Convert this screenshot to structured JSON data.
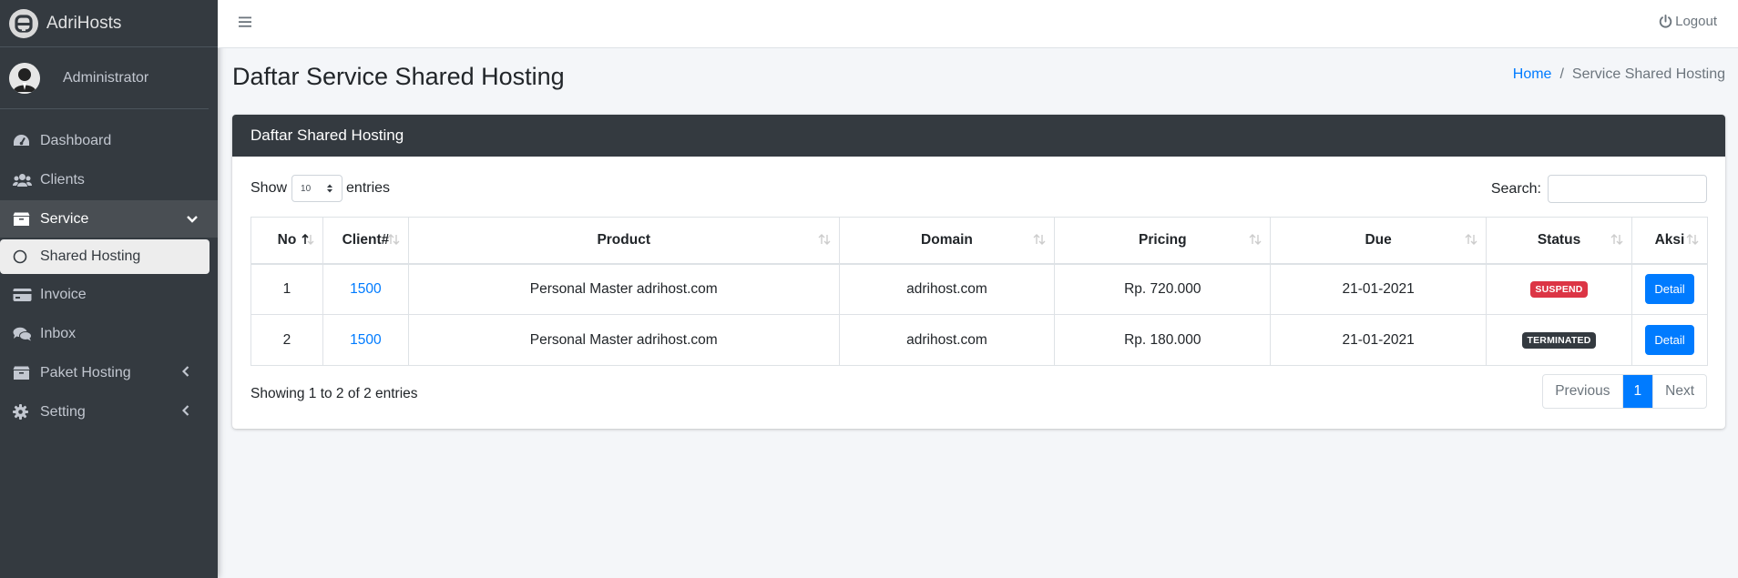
{
  "brand": {
    "name": "AdriHosts"
  },
  "user": {
    "name": "Administrator"
  },
  "sidebar": {
    "items": [
      {
        "label": "Dashboard",
        "icon": "tachometer-icon"
      },
      {
        "label": "Clients",
        "icon": "users-icon"
      },
      {
        "label": "Service",
        "icon": "box-icon"
      },
      {
        "label": "Shared Hosting",
        "icon": "circle-icon"
      },
      {
        "label": "Invoice",
        "icon": "credit-card-icon"
      },
      {
        "label": "Inbox",
        "icon": "comments-icon"
      },
      {
        "label": "Paket Hosting",
        "icon": "box-icon"
      },
      {
        "label": "Setting",
        "icon": "gear-icon"
      }
    ]
  },
  "navbar": {
    "logout_label": "Logout"
  },
  "page": {
    "title": "Daftar Service Shared Hosting"
  },
  "breadcrumb": {
    "home": "Home",
    "separator": "/",
    "current": "Service Shared Hosting"
  },
  "card": {
    "title": "Daftar Shared Hosting"
  },
  "table_controls": {
    "show_label": "Show",
    "entries_value": "10",
    "entries_label": "entries",
    "search_label": "Search:",
    "info": "Showing 1 to 2 of 2 entries"
  },
  "table": {
    "columns": [
      "No",
      "Client#",
      "Product",
      "Domain",
      "Pricing",
      "Due",
      "Status",
      "Aksi"
    ],
    "rows": [
      {
        "no": "1",
        "client": "1500",
        "product": "Personal Master adrihost.com",
        "domain": "adrihost.com",
        "pricing": "Rp. 720.000",
        "due": "21-01-2021",
        "status": "SUSPEND",
        "action": "Detail"
      },
      {
        "no": "2",
        "client": "1500",
        "product": "Personal Master adrihost.com",
        "domain": "adrihost.com",
        "pricing": "Rp. 180.000",
        "due": "21-01-2021",
        "status": "TERMINATED",
        "action": "Detail"
      }
    ]
  },
  "pagination": {
    "previous": "Previous",
    "current": "1",
    "next": "Next"
  },
  "colors": {
    "sidebar": "#343a40",
    "primary": "#007bff",
    "suspend": "#dc3545",
    "terminated": "#343a40"
  }
}
